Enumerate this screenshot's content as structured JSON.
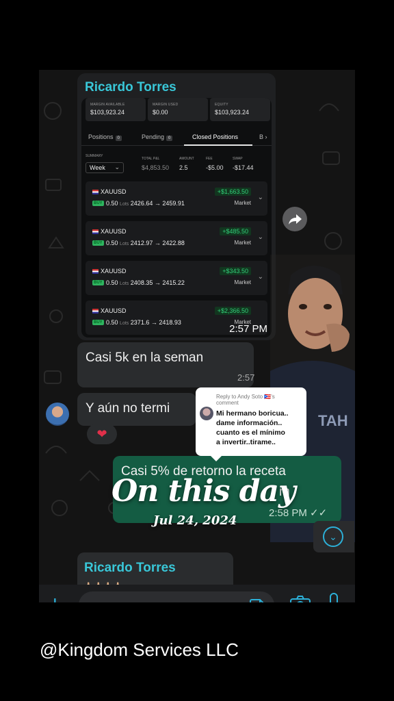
{
  "trade_screenshot": {
    "sender": "Ricardo Torres",
    "stats": [
      {
        "label": "MARGIN AVAILABLE",
        "value": "$103,923.24"
      },
      {
        "label": "MARGIN USED",
        "value": "$0.00"
      },
      {
        "label": "EQUITY",
        "value": "$103,923.24"
      }
    ],
    "tabs": [
      {
        "label": "Positions",
        "count": "0"
      },
      {
        "label": "Pending",
        "count": "0"
      },
      {
        "label": "Closed Positions",
        "count": ""
      },
      {
        "label": "B",
        "count": ""
      }
    ],
    "summary": {
      "summary_label": "SUMMARY",
      "period": "Week",
      "total_pl_label": "TOTAL P&L",
      "total_pl": "$4,853.50",
      "amount_label": "AMOUNT",
      "amount": "2.5",
      "fee_label": "FEE",
      "fee": "-$5.00",
      "swap_label": "SWAP",
      "swap": "-$17.44"
    },
    "trades": [
      {
        "symbol": "XAUUSD",
        "side": "BUY",
        "lots": "0.50",
        "lots_unit": "Lots",
        "open": "2426.64",
        "close": "2459.91",
        "pnl": "+$1,663.50",
        "type": "Market"
      },
      {
        "symbol": "XAUUSD",
        "side": "BUY",
        "lots": "0.50",
        "lots_unit": "Lots",
        "open": "2412.97",
        "close": "2422.88",
        "pnl": "+$485.50",
        "type": "Market"
      },
      {
        "symbol": "XAUUSD",
        "side": "BUY",
        "lots": "0.50",
        "lots_unit": "Lots",
        "open": "2408.35",
        "close": "2415.22",
        "pnl": "+$343.50",
        "type": "Market"
      },
      {
        "symbol": "XAUUSD",
        "side": "BUY",
        "lots": "0.50",
        "lots_unit": "Lots",
        "open": "2371.6",
        "close": "2418.93",
        "pnl": "+$2,366.50",
        "type": "Market"
      }
    ],
    "time": "2:57 PM"
  },
  "messages": {
    "incoming_1": {
      "text": "Casi 5k en la seman",
      "time": "2:57"
    },
    "incoming_2": {
      "text": "Y aún no termi",
      "reaction": "❤"
    },
    "outgoing_1": {
      "text_line1": "Casi 5% de retorno la receta",
      "text_line2": "m",
      "time": "2:58 PM"
    }
  },
  "reply_sticker": {
    "header_line1": "Reply to Andy Soto 🇵🇷's",
    "header_line2": "comment",
    "body_line1": "Mi hermano boricua..",
    "body_line2": "dame información..",
    "body_line3": "cuanto es el mínimo",
    "body_line4": "a invertir..tirame.."
  },
  "next_message": {
    "sender": "Ricardo Torres",
    "preview": "🙏🏻🙏🏻🙏🏻🙏🏻"
  },
  "overlay": {
    "title": "On this day",
    "date": "Jul 24, 2024"
  },
  "watermark": "@Kingdom Services LLC",
  "colors": {
    "accent": "#2cb0d8",
    "sender_name": "#39c7d8",
    "outgoing_bubble": "#145c43",
    "profit": "#32d07a"
  },
  "icons": [
    "forward-icon",
    "chevron-down-icon",
    "plus-icon",
    "sticker-icon",
    "camera-icon",
    "microphone-icon",
    "heart-icon"
  ]
}
